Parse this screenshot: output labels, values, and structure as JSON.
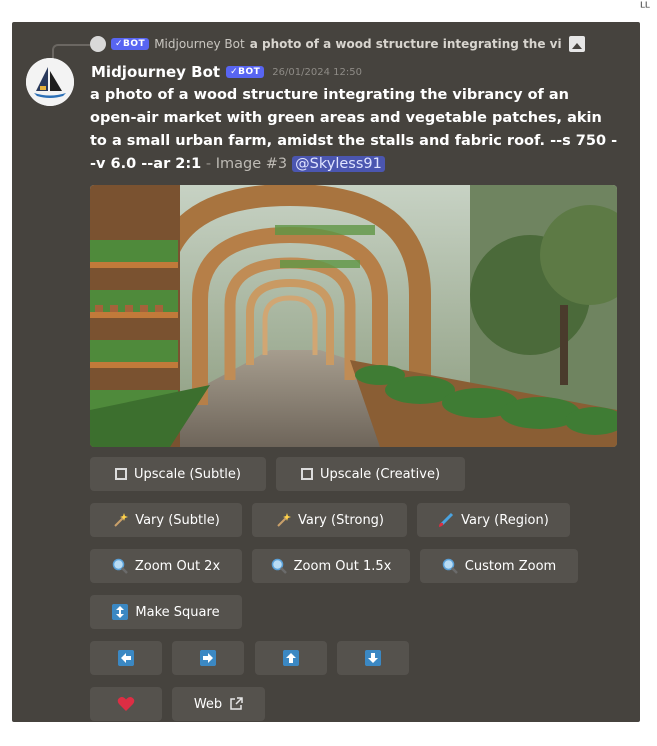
{
  "reply": {
    "bot_name": "Midjourney Bot",
    "badge": "✓BOT",
    "text": "a photo of a wood structure integrating the vi"
  },
  "message": {
    "username": "Midjourney Bot",
    "badge": "✓BOT",
    "timestamp": "26/01/2024 12:50",
    "prompt": "a photo of a wood structure integrating the vibrancy of an open-air market with green areas and vegetable patches, akin to a small urban farm, amidst the stalls and fabric roof. --s 750 --v 6.0 --ar 2:1",
    "separator": " - ",
    "image_number": "Image #3",
    "mention": "@Skyless91"
  },
  "buttons": {
    "upscale_subtle": "Upscale (Subtle)",
    "upscale_creative": "Upscale (Creative)",
    "vary_subtle": "Vary (Subtle)",
    "vary_strong": "Vary (Strong)",
    "vary_region": "Vary (Region)",
    "zoom_out_2x": "Zoom Out 2x",
    "zoom_out_1_5x": "Zoom Out 1.5x",
    "custom_zoom": "Custom Zoom",
    "make_square": "Make Square",
    "web": "Web"
  },
  "icons": {
    "upscale": "expand-corners-icon",
    "vary": "magic-wand-icon",
    "vary_region": "paintbrush-icon",
    "zoom": "magnifier-icon",
    "make_square": "vertical-arrows-icon",
    "pan_left": "arrow-left-icon",
    "pan_right": "arrow-right-icon",
    "pan_up": "arrow-up-icon",
    "pan_down": "arrow-down-icon",
    "favorite": "heart-icon",
    "external": "external-link-icon"
  },
  "colors": {
    "card_bg": "#46433e",
    "button_bg": "#55524d",
    "badge_bg": "#5865f2",
    "mention_bg": "#4b56b0",
    "arrow_blue": "#3b88c3",
    "heart_red": "#dd2e44"
  }
}
